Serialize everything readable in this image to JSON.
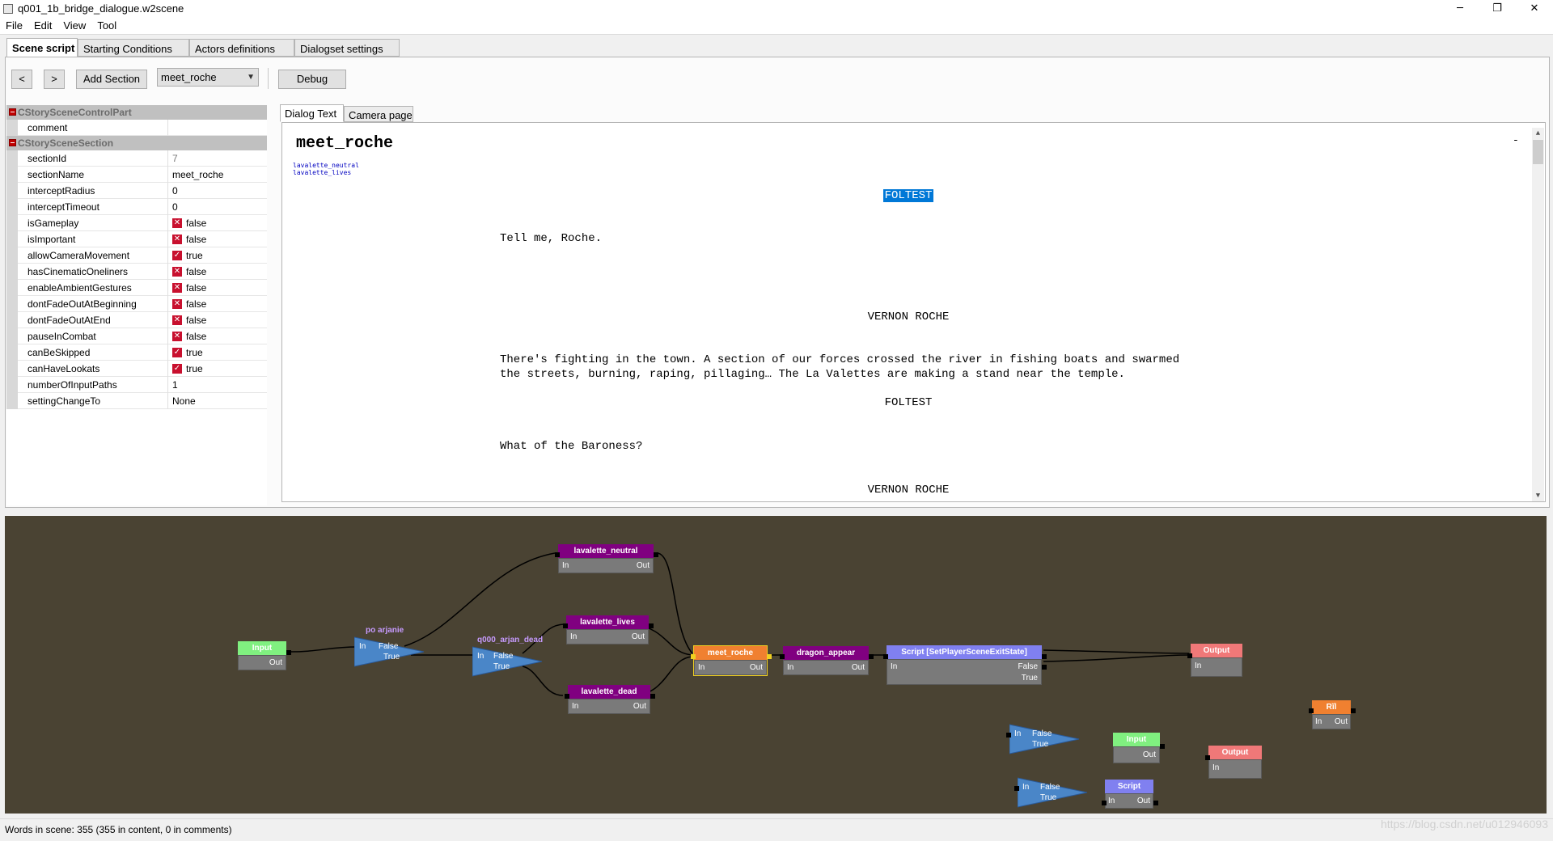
{
  "window": {
    "title": "q001_1b_bridge_dialogue.w2scene",
    "minimize": "─",
    "restore": "❐",
    "close": "✕"
  },
  "menu": [
    "File",
    "Edit",
    "View",
    "Tool"
  ],
  "tabs": [
    "Scene script",
    "Starting Conditions",
    "Actors definitions",
    "Dialogset settings"
  ],
  "toolbar": {
    "prev": "<",
    "next": ">",
    "add_section": "Add Section",
    "section_select": "meet_roche",
    "debug": "Debug"
  },
  "properties": {
    "categories": [
      "CStorySceneControlPart",
      "CStorySceneSection"
    ],
    "control_part": [
      {
        "name": "comment",
        "value": ""
      }
    ],
    "section": [
      {
        "name": "sectionId",
        "value": "7"
      },
      {
        "name": "sectionName",
        "value": "meet_roche"
      },
      {
        "name": "interceptRadius",
        "value": "0"
      },
      {
        "name": "interceptTimeout",
        "value": "0"
      },
      {
        "name": "isGameplay",
        "value": "false"
      },
      {
        "name": "isImportant",
        "value": "false"
      },
      {
        "name": "allowCameraMovement",
        "value": "true"
      },
      {
        "name": "hasCinematicOneliners",
        "value": "false"
      },
      {
        "name": "enableAmbientGestures",
        "value": "false"
      },
      {
        "name": "dontFadeOutAtBeginning",
        "value": "false"
      },
      {
        "name": "dontFadeOutAtEnd",
        "value": "false"
      },
      {
        "name": "pauseInCombat",
        "value": "false"
      },
      {
        "name": "canBeSkipped",
        "value": "true"
      },
      {
        "name": "canHaveLookats",
        "value": "true"
      },
      {
        "name": "numberOfInputPaths",
        "value": "1"
      },
      {
        "name": "settingChangeTo",
        "value": "None"
      }
    ]
  },
  "dialog_tabs": [
    "Dialog Text",
    "Camera page"
  ],
  "dialog": {
    "heading": "meet_roche",
    "tags": [
      "lavalette_neutral",
      "lavalette_lives"
    ],
    "dash": "-",
    "blocks": [
      {
        "actor": "FOLTEST",
        "selected": true,
        "line1": "Tell me, Roche.",
        "line2": ""
      },
      {
        "actor": "VERNON ROCHE",
        "selected": false,
        "line1": "There's fighting in the town. A section of our forces crossed the river in fishing boats and swarmed",
        "line2": "the streets, burning, raping, pillaging… The La Valettes are making a stand near the temple."
      },
      {
        "actor": "FOLTEST",
        "selected": false,
        "line1": "What of the Baroness?",
        "line2": ""
      },
      {
        "actor": "VERNON ROCHE",
        "selected": false,
        "line1": "",
        "line2": ""
      }
    ],
    "scroll_up": "▲",
    "scroll_down": "▼"
  },
  "graph": {
    "colors": {
      "input": "#80f080",
      "output": "#f07878",
      "section": "#800080",
      "current": "#f08030",
      "script": "#8080f0",
      "cond": "#4a86c8"
    },
    "pins": {
      "in": "In",
      "out": "Out",
      "false": "False",
      "true": "True"
    },
    "nodes": {
      "input1": "Input",
      "cond1": "po arjanie",
      "cond2": "q000_arjan_dead",
      "lavalette_neutral": "lavalette_neutral",
      "lavalette_lives": "lavalette_lives",
      "lavalette_dead": "lavalette_dead",
      "meet_roche": "meet_roche",
      "dragon_appear": "dragon_appear",
      "script1": "Script [SetPlayerSceneExitState]",
      "output1": "Output",
      "bonus": "Rĭl",
      "input2": "Input",
      "output2": "Output",
      "script2": "Script"
    }
  },
  "status": "Words in scene: 355 (355 in content, 0 in comments)",
  "watermark": "https://blog.csdn.net/u012946093"
}
